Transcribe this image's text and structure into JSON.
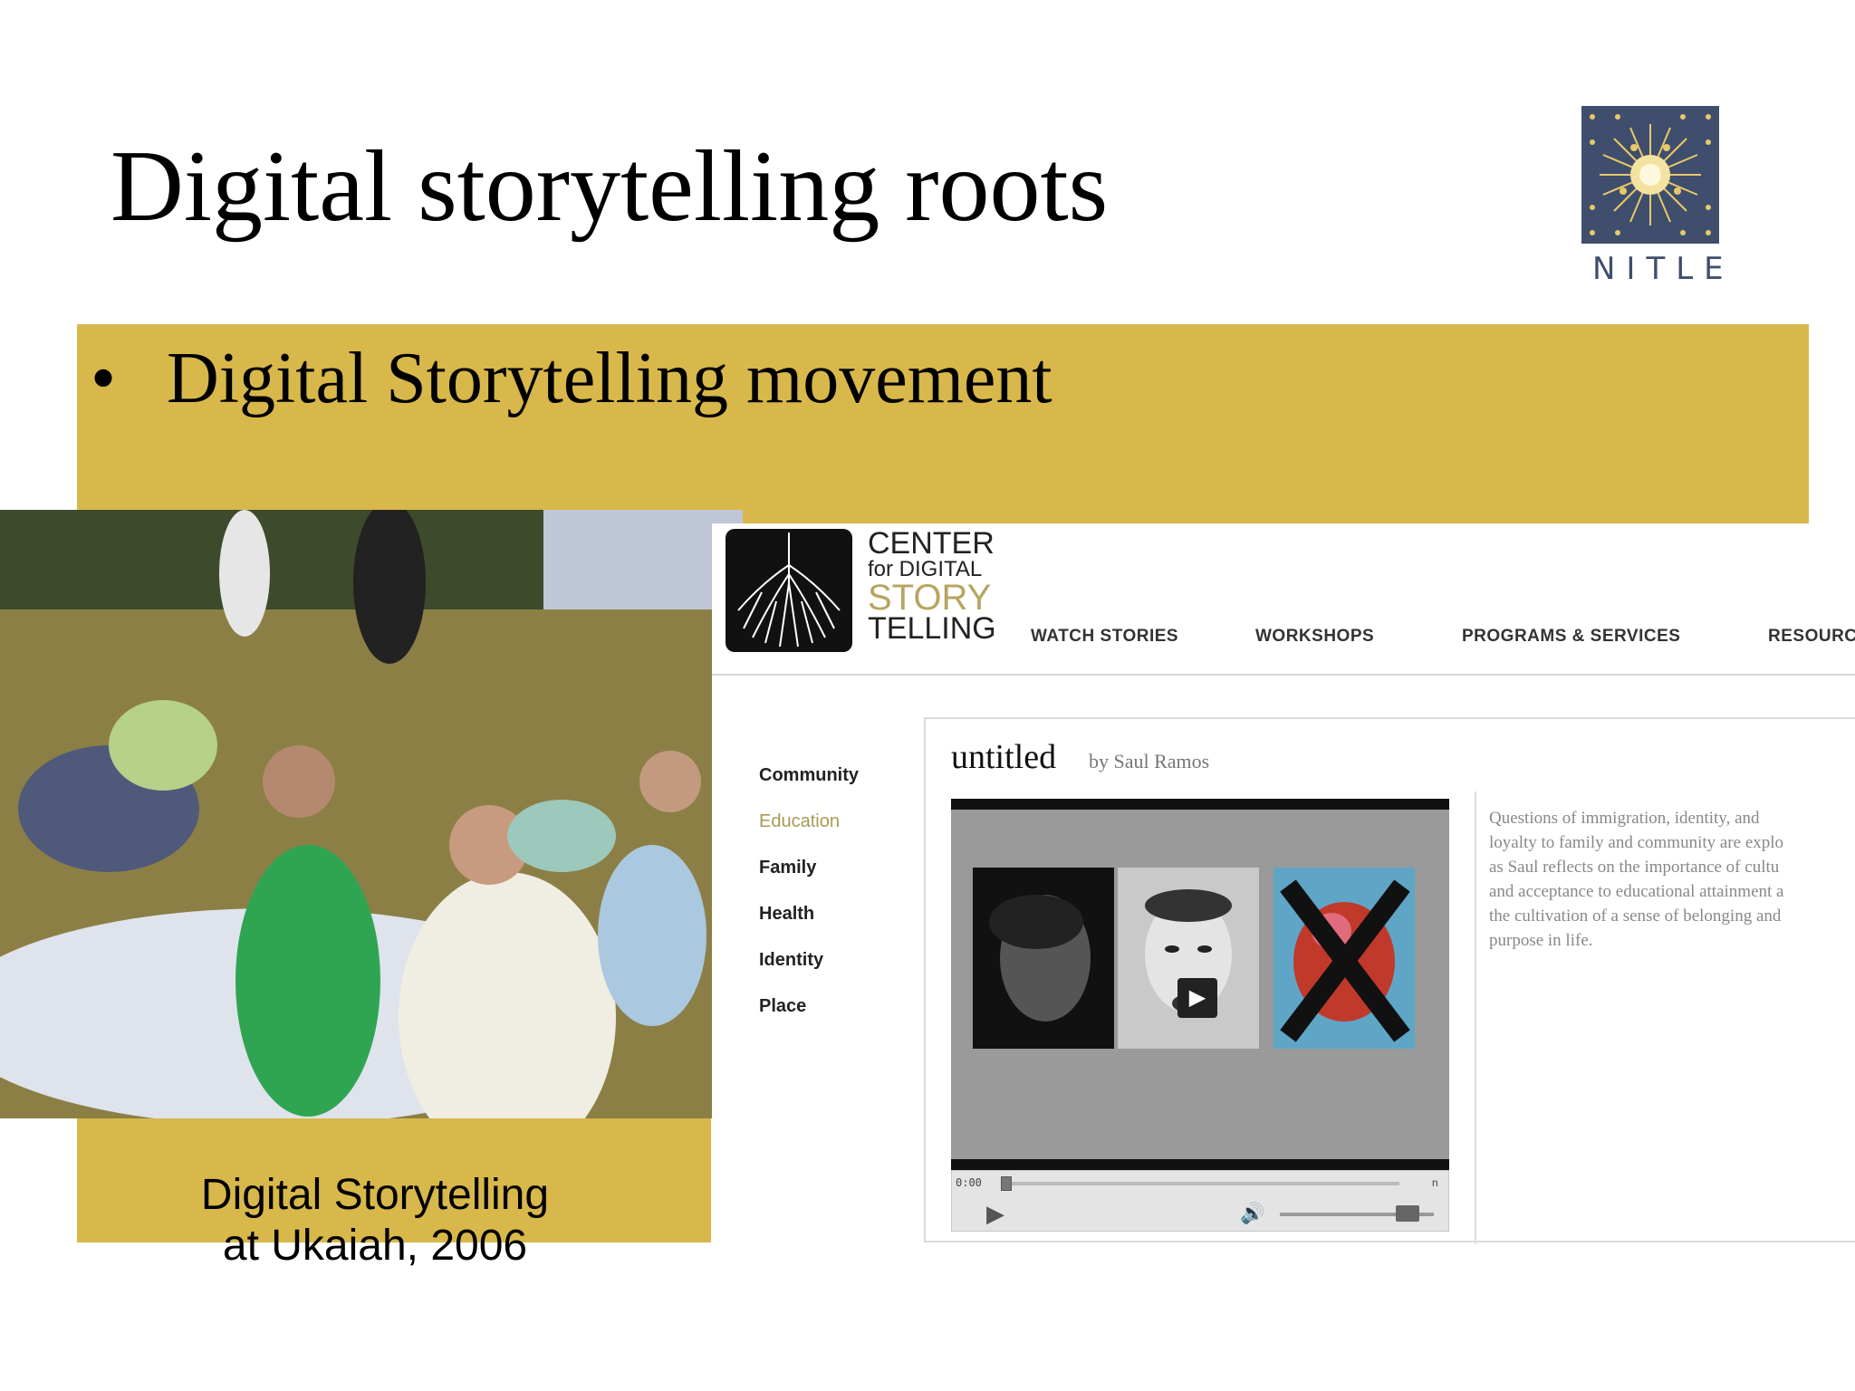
{
  "slide": {
    "title": "Digital storytelling roots",
    "bullet_marker": "•",
    "bullet": "Digital Storytelling movement",
    "accent_color": "#d8b84a"
  },
  "logo": {
    "text": "NITLE",
    "color": "#3f4e6d"
  },
  "photo": {
    "caption_line1": "Digital Storytelling",
    "caption_line2": "at Ukaiah, 2006"
  },
  "website": {
    "name_line1": "CENTER",
    "name_line2": "for DIGITAL",
    "name_line3": "STORY",
    "name_line4": "TELLING",
    "nav": [
      "WATCH STORIES",
      "WORKSHOPS",
      "PROGRAMS & SERVICES",
      "RESOURC"
    ],
    "categories": [
      {
        "label": "Community",
        "active": false
      },
      {
        "label": "Education",
        "active": true
      },
      {
        "label": "Family",
        "active": false
      },
      {
        "label": "Health",
        "active": false
      },
      {
        "label": "Identity",
        "active": false
      },
      {
        "label": "Place",
        "active": false
      }
    ],
    "story": {
      "title": "untitled",
      "author": "by Saul Ramos",
      "description_lines": [
        "Questions of immigration, identity, and",
        "loyalty to family and community are explo",
        "as Saul reflects on the importance of cultu",
        "and acceptance to educational attainment a",
        "the cultivation of a sense of belonging and",
        "purpose in life."
      ]
    },
    "player": {
      "time": "0:00",
      "end_mark": "n",
      "play_symbol": "▶",
      "volume_symbol": "🔊"
    }
  }
}
